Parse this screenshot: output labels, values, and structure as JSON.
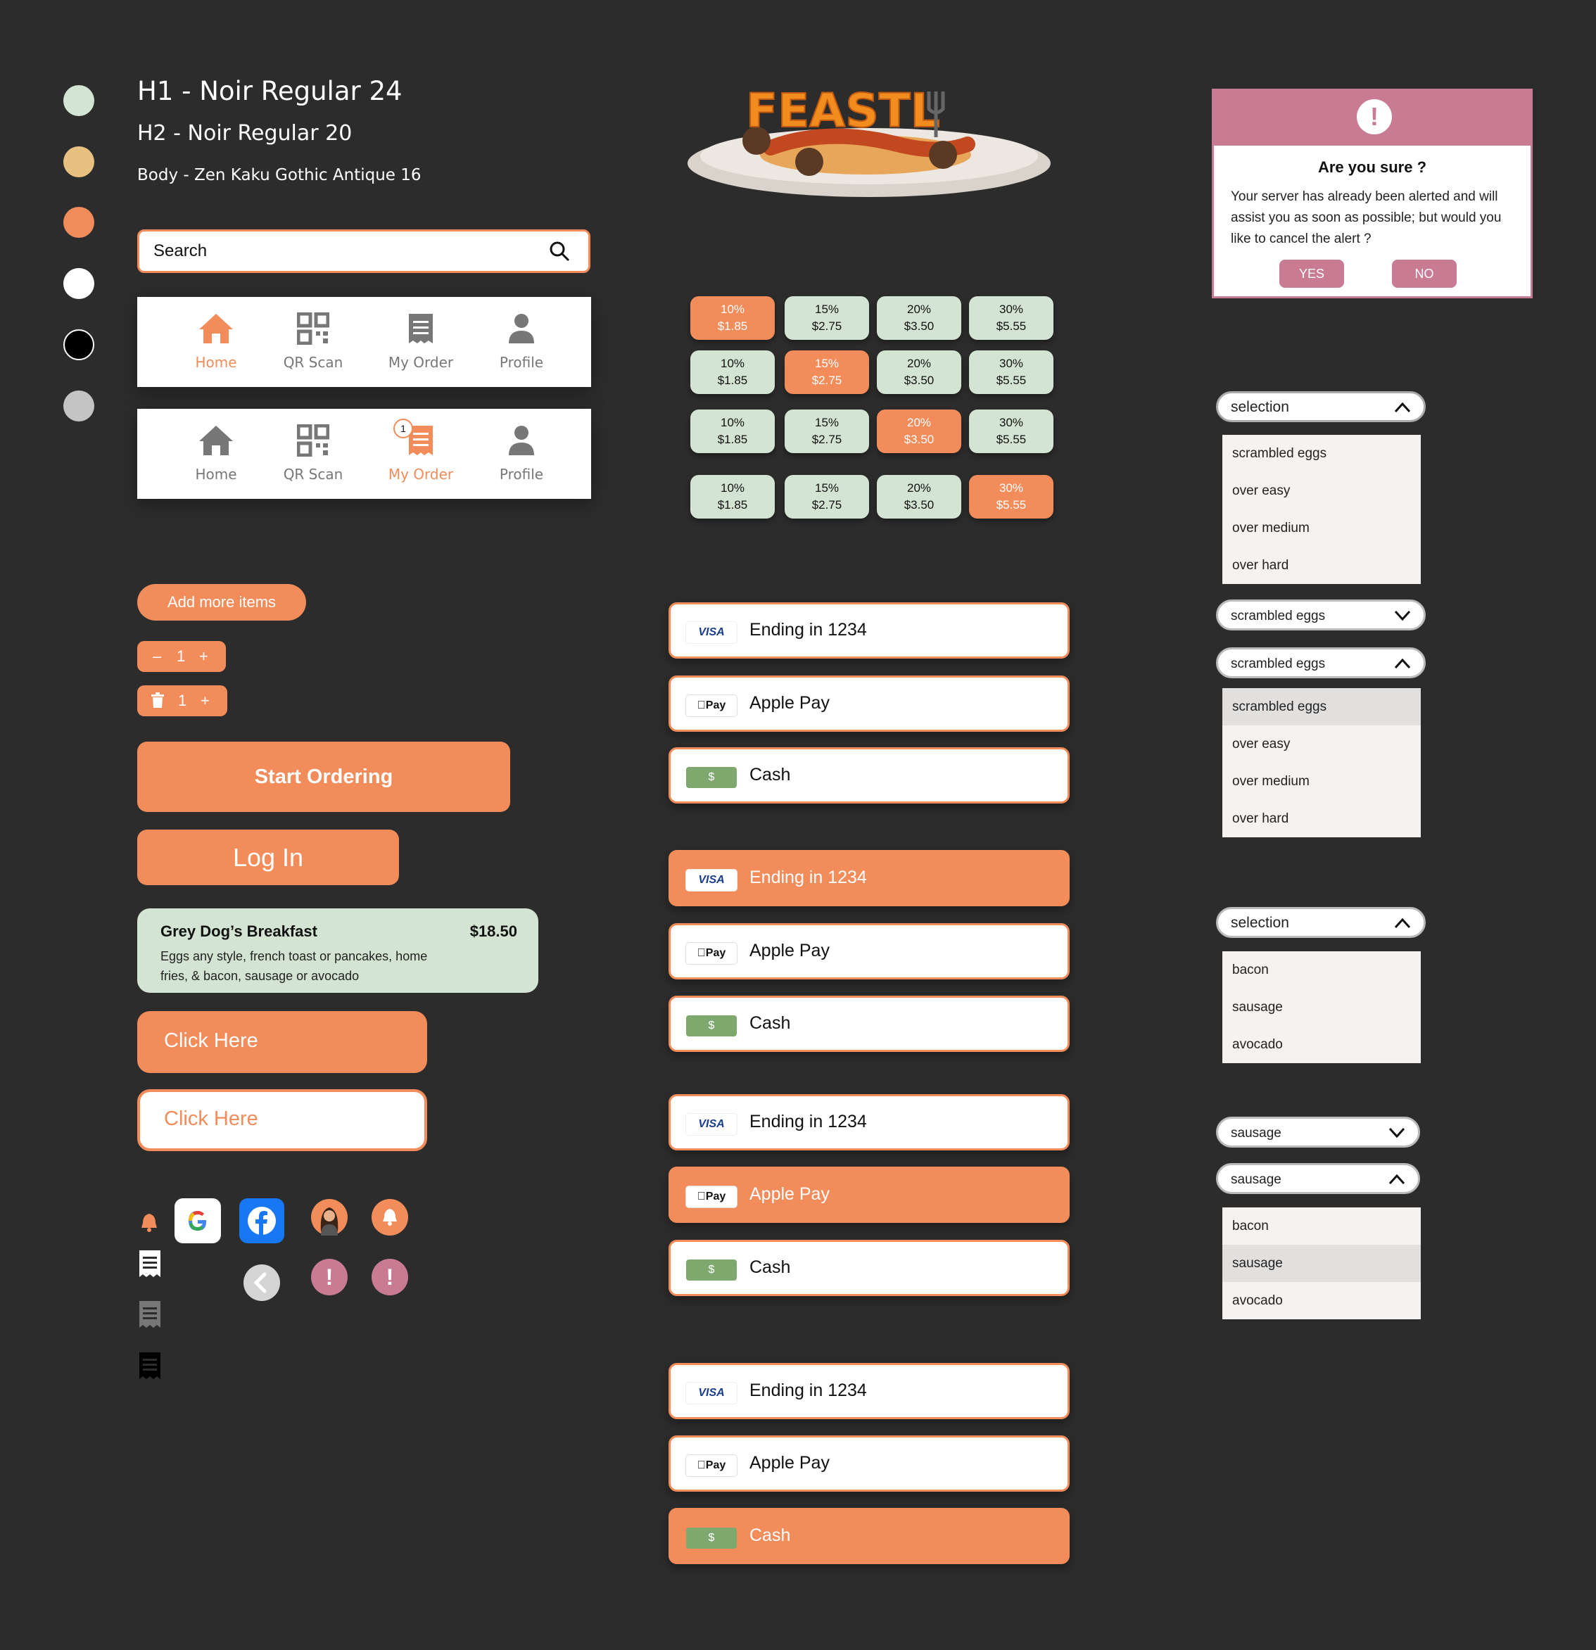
{
  "colors": {
    "swatches": [
      "#d4e4d2",
      "#e8c07f",
      "#f28c5a",
      "#ffffff",
      "#000000",
      "#c4c4c4"
    ],
    "accent": "#f28c5a",
    "mint": "#d4e4d2",
    "alert_pink": "#c97b93",
    "background": "#2c2c2c"
  },
  "typography": {
    "h1": "H1 - Noir Regular 24",
    "h2": "H2 - Noir Regular 20",
    "body": "Body - Zen Kaku Gothic Antique 16"
  },
  "logo": {
    "text": "FEASTLY"
  },
  "search": {
    "placeholder": "Search"
  },
  "navbar": {
    "items": [
      {
        "label": "Home",
        "icon": "home-icon"
      },
      {
        "label": "QR Scan",
        "icon": "qr-icon"
      },
      {
        "label": "My Order",
        "icon": "receipt-icon"
      },
      {
        "label": "Profile",
        "icon": "user-icon"
      }
    ],
    "badge_count": "1"
  },
  "add_more": {
    "label": "Add more items"
  },
  "stepper": {
    "minus": "–",
    "qty": "1",
    "plus": "+"
  },
  "start_ordering": {
    "label": "Start Ordering"
  },
  "login": {
    "label": "Log In"
  },
  "menu_card": {
    "title": "Grey Dog’s Breakfast",
    "price": "$18.50",
    "description": "Eggs any style, french toast or pancakes, home fries, & bacon, sausage or avocado"
  },
  "click_here": {
    "label": "Click Here"
  },
  "tips": [
    {
      "pct": "10%",
      "amt": "$1.85"
    },
    {
      "pct": "15%",
      "amt": "$2.75"
    },
    {
      "pct": "20%",
      "amt": "$3.50"
    },
    {
      "pct": "30%",
      "amt": "$5.55"
    }
  ],
  "payment": {
    "card": {
      "chip": "VISA",
      "label": "Ending in 1234"
    },
    "apple": {
      "chip": "Pay",
      "label": "Apple Pay"
    },
    "cash": {
      "chip": "$",
      "label": "Cash"
    }
  },
  "alert": {
    "title": "Are you sure ?",
    "message": "Your server has already been alerted and will assist you as soon as possible; but would you like to cancel the alert ?",
    "yes": "YES",
    "no": "NO"
  },
  "egg_dropdown": {
    "placeholder": "selection",
    "selected": "scrambled eggs",
    "options": [
      "scrambled eggs",
      "over easy",
      "over medium",
      "over hard"
    ]
  },
  "side_dropdown": {
    "placeholder": "selection",
    "selected": "sausage",
    "options": [
      "bacon",
      "sausage",
      "avocado"
    ]
  },
  "icons": [
    "bell-icon",
    "google-icon",
    "facebook-icon",
    "avatar",
    "bell-circle-icon",
    "receipt-white-icon",
    "back-icon",
    "alert-icon",
    "receipt-gray-icon",
    "receipt-black-icon"
  ]
}
